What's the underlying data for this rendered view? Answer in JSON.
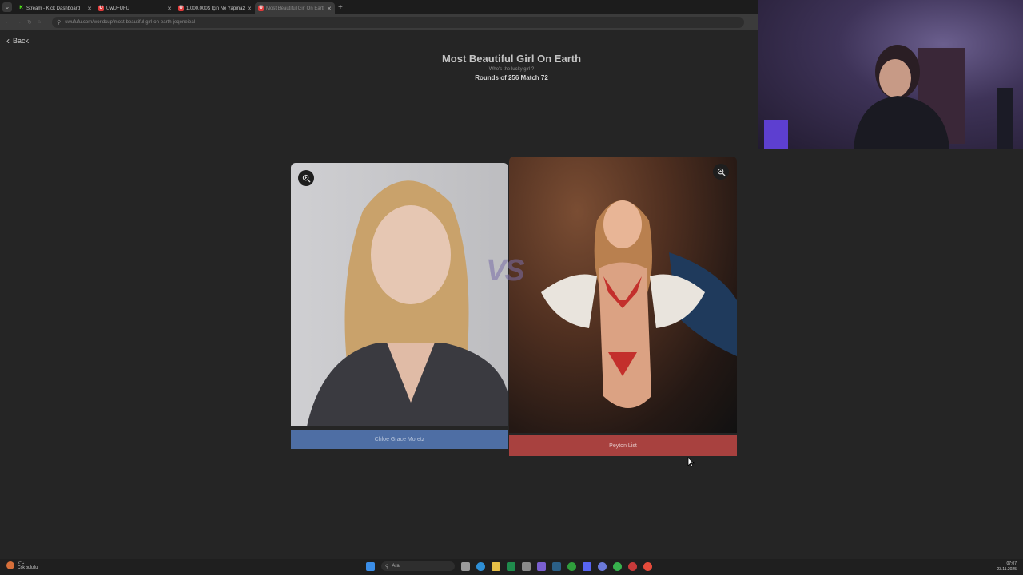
{
  "browser": {
    "tabs": [
      {
        "label": "Stream - Kick Dashboard",
        "favicon": "K",
        "color": "#53fc18",
        "active": false
      },
      {
        "label": "UwUFUFU",
        "favicon": "U",
        "color": "#e03a3a",
        "active": false
      },
      {
        "label": "1,000,000$ İçin Ne Yapmazsın! |",
        "favicon": "U",
        "color": "#e03a3a",
        "active": false
      },
      {
        "label": "Most Beautiful Girl On Earth |",
        "favicon": "U",
        "color": "#e03a3a",
        "active": true
      }
    ],
    "url": "uwufufu.com/worldcup/most-beautiful-girl-on-earth-jeqeneieal"
  },
  "page": {
    "back_label": "Back",
    "title": "Most Beautiful Girl On Earth",
    "subtitle": "Who's the lucky girl ?",
    "round_info": "Rounds of 256 Match 72",
    "vs_label": "VS",
    "left_choice": {
      "name": "Chloe Grace Moretz",
      "button_color": "#4e6ea4"
    },
    "right_choice": {
      "name": "Peyton List",
      "button_color": "#a8413f"
    }
  },
  "taskbar": {
    "weather_temp": "2°C",
    "weather_desc": "Çok bulutlu",
    "search_placeholder": "Ara",
    "time": "07:07",
    "date": "23.11.2025"
  }
}
